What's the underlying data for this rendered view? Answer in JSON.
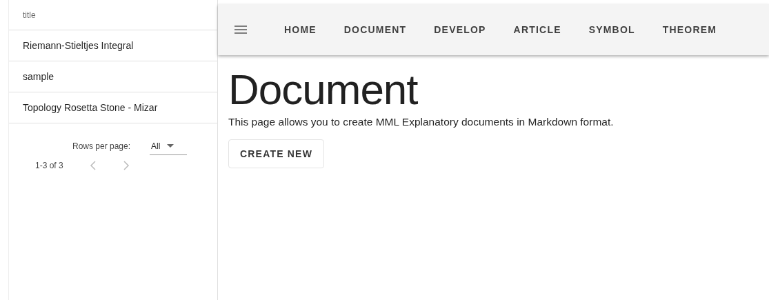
{
  "table": {
    "columns": [
      "title"
    ],
    "rows": [
      "Riemann-Stieltjes Integral",
      "sample",
      "Topology Rosetta Stone - Mizar"
    ],
    "pagination": {
      "rows_per_page_label": "Rows per page:",
      "rows_per_page": "All",
      "range": "1-3 of 3"
    }
  },
  "nav": {
    "items": [
      "HOME",
      "DOCUMENT",
      "DEVELOP",
      "ARTICLE",
      "SYMBOL",
      "THEOREM"
    ]
  },
  "page": {
    "heading": "Document",
    "description": "This page allows you to create MML Explanatory documents in Markdown format.",
    "button": "CREATE NEW"
  }
}
